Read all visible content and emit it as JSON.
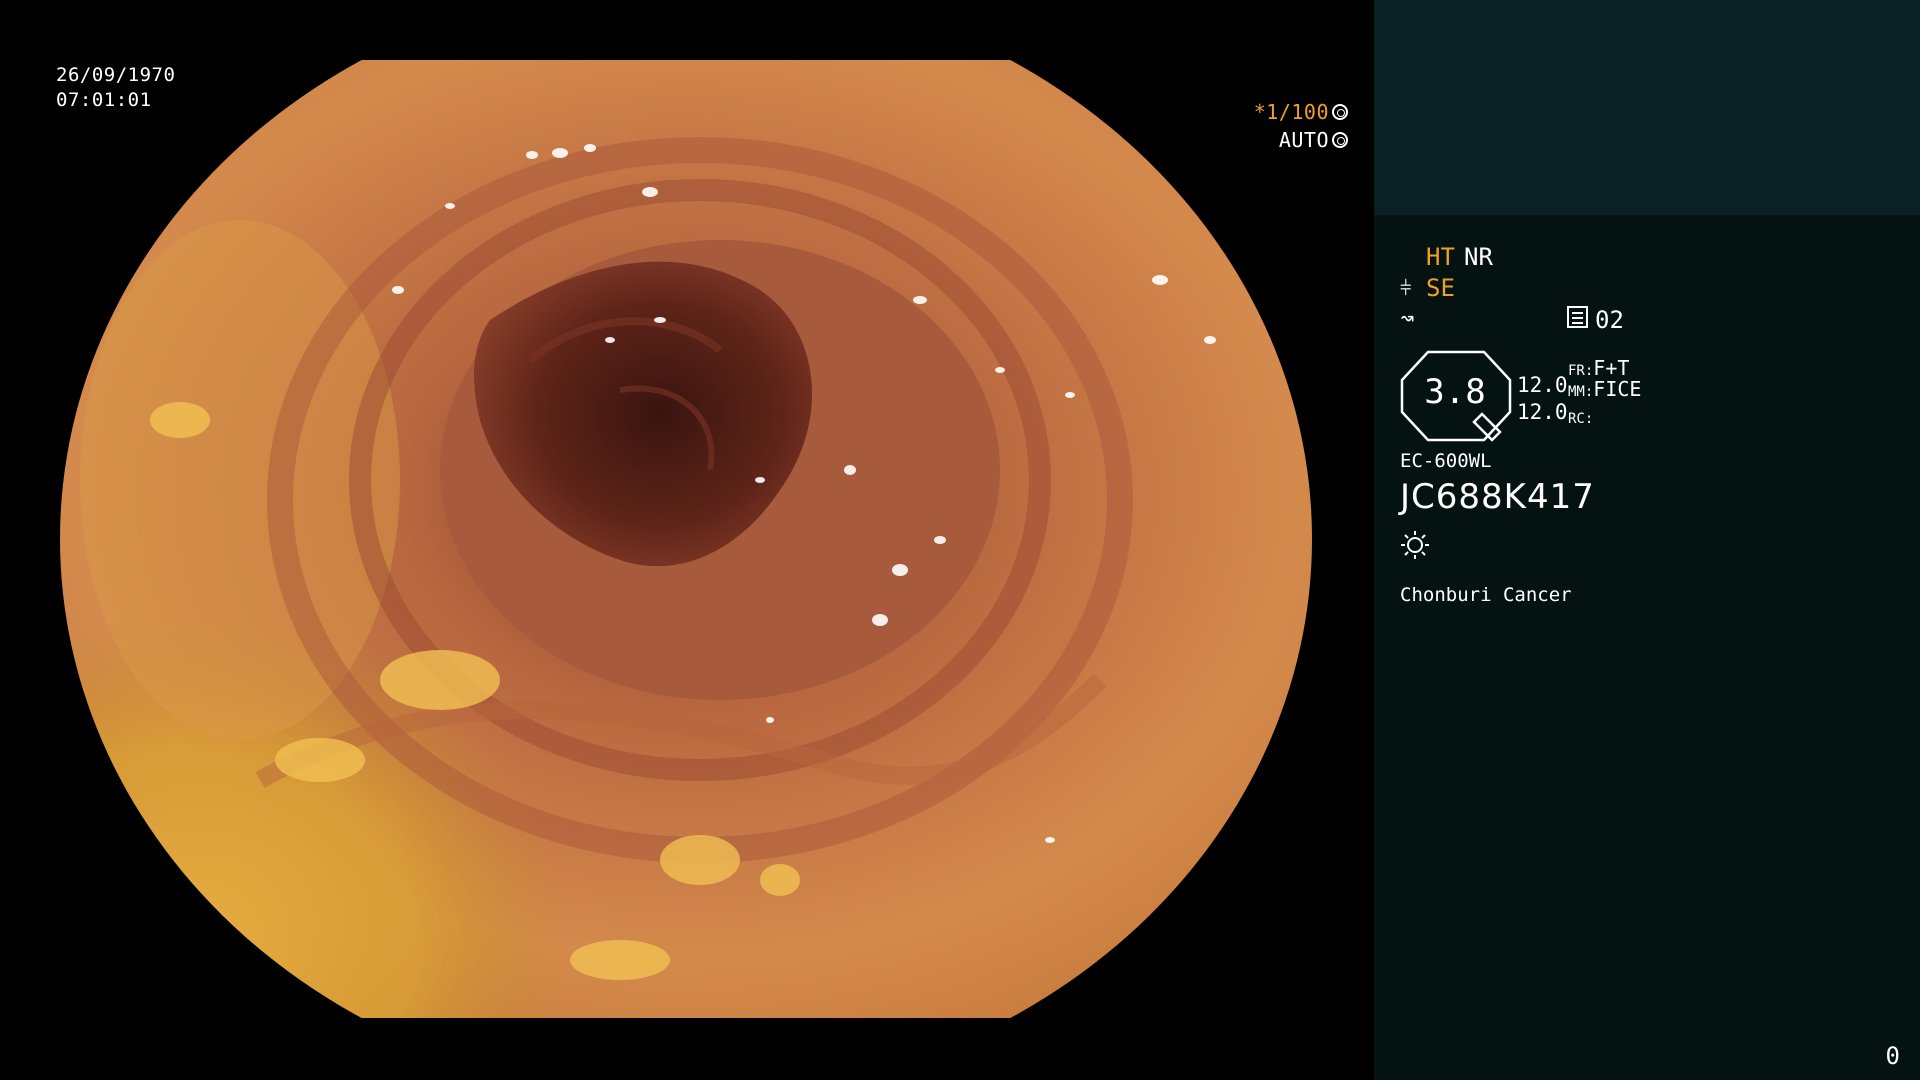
{
  "overlay": {
    "date": "26/09/1970",
    "time": "07:01:01",
    "shutter": "*1/100",
    "iris": "AUTO"
  },
  "panel": {
    "mode_ht": "HT",
    "mode_nr": "NR",
    "mode_se": "SE",
    "page_number": "02",
    "zoom_value": "3.8",
    "value_a": "12.0",
    "value_b": "12.0",
    "fr_label": "FR:",
    "fr_value": "F+T",
    "mm_label": "MM:",
    "mm_value": "FICE",
    "rc_label": "RC:",
    "scope_model": "EC-600WL",
    "scope_serial": "JC688K417",
    "site": "Chonburi Cancer",
    "counter": "0"
  },
  "icons": {
    "shutter_icon": "aperture-icon",
    "iris_icon": "iris-icon",
    "structure_icon": "structure-enhance-icon",
    "zigzag_icon": "zigzag-icon",
    "pages_icon": "document-icon",
    "light_icon": "light-source-icon"
  },
  "colors": {
    "accent": "#f0a020",
    "panel_bg": "#041311",
    "panel_top_bg": "#0b2022"
  }
}
